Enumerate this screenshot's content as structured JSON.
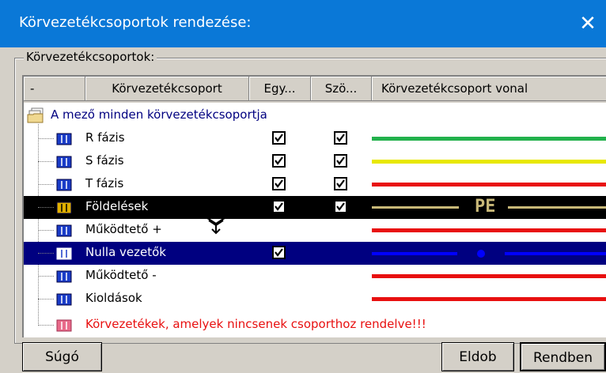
{
  "window": {
    "title": "Körvezetékcsoportok rendezése:",
    "close_glyph": "✕"
  },
  "group_label": "Körvezetékcsoportok:",
  "columns": [
    "-",
    "Körvezetékcsoport",
    "Egy...",
    "Szö...",
    "Körvezetékcsoport vonal"
  ],
  "root": {
    "label": "A mező minden körvezetékcsoportja",
    "icon": "folder-stack-icon",
    "color": "#000080"
  },
  "rows": [
    {
      "label": "R fázis",
      "col3_checked": true,
      "col4_checked": true,
      "line_color": "#22b14c",
      "line_style": "solid"
    },
    {
      "label": "S fázis",
      "col3_checked": true,
      "col4_checked": true,
      "line_color": "#e8e800",
      "line_style": "solid"
    },
    {
      "label": "T fázis",
      "col3_checked": true,
      "col4_checked": true,
      "line_color": "#e81010",
      "line_style": "solid"
    },
    {
      "label": "Földelések",
      "col3_checked": true,
      "col4_checked": true,
      "line_color": "#c8b878",
      "line_style": "pe",
      "line_text": "PE",
      "selected": "black"
    },
    {
      "label": "Működtető +",
      "col3_checked": false,
      "col4_checked": false,
      "line_color": "#e81010",
      "line_style": "solid"
    },
    {
      "label": "Nulla vezetők",
      "col3_checked": true,
      "col4_checked": false,
      "line_color": "#0000ff",
      "line_style": "dash-dot",
      "selected": "blue"
    },
    {
      "label": "Működtető -",
      "col3_checked": false,
      "col4_checked": false,
      "line_color": "#e81010",
      "line_style": "solid"
    },
    {
      "label": "Kioldások",
      "col3_checked": false,
      "col4_checked": false,
      "line_color": "#e81010",
      "line_style": "solid"
    }
  ],
  "unassigned": {
    "label": "Körvezetékek, amelyek nincsenek csoporthoz rendelve!!!",
    "color": "#e81010"
  },
  "buttons": {
    "help": "Súgó",
    "discard": "Eldob",
    "ok": "Rendben"
  },
  "colors": {
    "titlebar": "#0a78d7",
    "dialog_bg": "#d4d0c8",
    "selection_blue": "#000080",
    "icon_blue": "#1a3cc8",
    "icon_yellow": "#e0b000",
    "icon_pink": "#e86a8a"
  }
}
